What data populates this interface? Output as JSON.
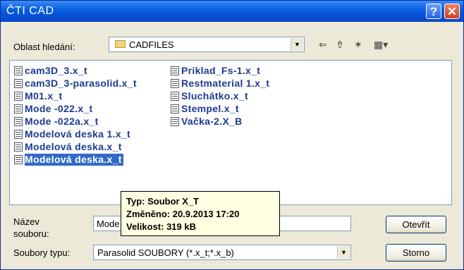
{
  "window": {
    "title": "ČTI CAD",
    "help_glyph": "?",
    "close_glyph": "✕"
  },
  "lookin": {
    "label": "Oblast hledání:",
    "value": "CADFILES",
    "arrow": "▼"
  },
  "toolbar": {
    "back_glyph": "⇐",
    "up_glyph": "⇮",
    "newfolder_glyph": "✶",
    "view_glyph": "▦▾"
  },
  "files": {
    "col1": [
      "cam3D_3.x_t",
      "cam3D_3-parasolid.x_t",
      "M01.x_t",
      "Mode -022.x_t",
      "Mode -022a.x_t",
      "Modelová deska 1.x_t",
      "Modelová deska.x_t",
      "Modelová deska.x_t"
    ],
    "col2": [
      "Priklad_Fs-1.x_t",
      "Restmaterial 1.x_t",
      "Sluchátko.x_t",
      "Stempel.x_t",
      "Vačka-2.X_B"
    ],
    "selected_index": 7
  },
  "filename": {
    "label_line1": "Název",
    "label_line2": "souboru:",
    "value": "Mode"
  },
  "filetype": {
    "label": "Soubory typu:",
    "value": "Parasolid SOUBORY (*.x_t;*.x_b)",
    "arrow": "▼"
  },
  "buttons": {
    "open": "Otevřít",
    "cancel": "Storno"
  },
  "tooltip": {
    "line1": "Typ: Soubor X_T",
    "line2": "Změněno: 20.9.2013 17:20",
    "line3": "Velikost: 319 kB"
  }
}
